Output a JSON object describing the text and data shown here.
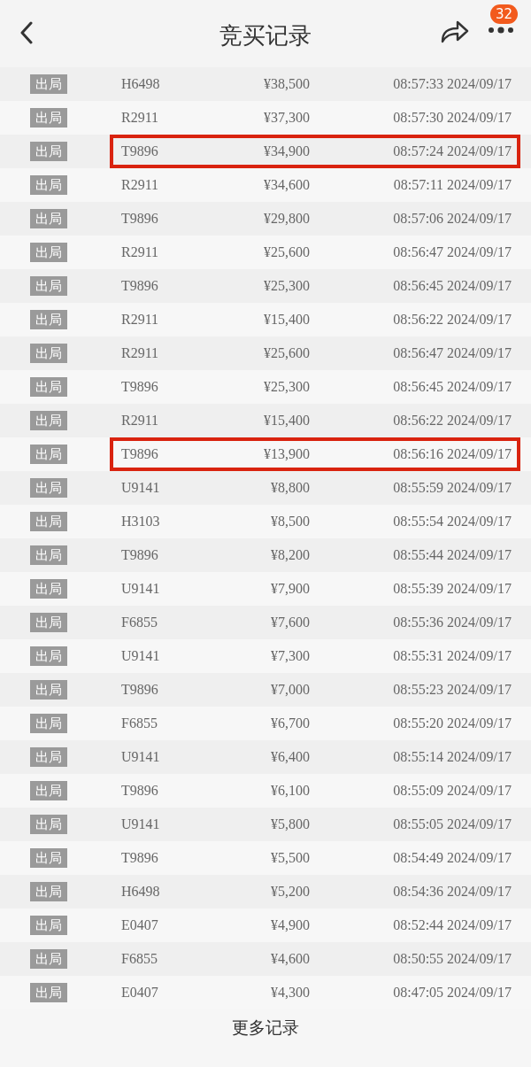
{
  "header": {
    "title": "竞买记录",
    "notification_count": "32"
  },
  "records": [
    {
      "status": "出局",
      "bidder": "H6498",
      "price": "¥38,500",
      "time": "08:57:33 2024/09/17",
      "highlighted": false
    },
    {
      "status": "出局",
      "bidder": "R2911",
      "price": "¥37,300",
      "time": "08:57:30 2024/09/17",
      "highlighted": false
    },
    {
      "status": "出局",
      "bidder": "T9896",
      "price": "¥34,900",
      "time": "08:57:24 2024/09/17",
      "highlighted": true
    },
    {
      "status": "出局",
      "bidder": "R2911",
      "price": "¥34,600",
      "time": "08:57:11 2024/09/17",
      "highlighted": false
    },
    {
      "status": "出局",
      "bidder": "T9896",
      "price": "¥29,800",
      "time": "08:57:06 2024/09/17",
      "highlighted": false
    },
    {
      "status": "出局",
      "bidder": "R2911",
      "price": "¥25,600",
      "time": "08:56:47 2024/09/17",
      "highlighted": false
    },
    {
      "status": "出局",
      "bidder": "T9896",
      "price": "¥25,300",
      "time": "08:56:45 2024/09/17",
      "highlighted": false
    },
    {
      "status": "出局",
      "bidder": "R2911",
      "price": "¥15,400",
      "time": "08:56:22 2024/09/17",
      "highlighted": false
    },
    {
      "status": "出局",
      "bidder": "R2911",
      "price": "¥25,600",
      "time": "08:56:47 2024/09/17",
      "highlighted": false
    },
    {
      "status": "出局",
      "bidder": "T9896",
      "price": "¥25,300",
      "time": "08:56:45 2024/09/17",
      "highlighted": false
    },
    {
      "status": "出局",
      "bidder": "R2911",
      "price": "¥15,400",
      "time": "08:56:22 2024/09/17",
      "highlighted": false
    },
    {
      "status": "出局",
      "bidder": "T9896",
      "price": "¥13,900",
      "time": "08:56:16 2024/09/17",
      "highlighted": true
    },
    {
      "status": "出局",
      "bidder": "U9141",
      "price": "¥8,800",
      "time": "08:55:59 2024/09/17",
      "highlighted": false
    },
    {
      "status": "出局",
      "bidder": "H3103",
      "price": "¥8,500",
      "time": "08:55:54 2024/09/17",
      "highlighted": false
    },
    {
      "status": "出局",
      "bidder": "T9896",
      "price": "¥8,200",
      "time": "08:55:44 2024/09/17",
      "highlighted": false
    },
    {
      "status": "出局",
      "bidder": "U9141",
      "price": "¥7,900",
      "time": "08:55:39 2024/09/17",
      "highlighted": false
    },
    {
      "status": "出局",
      "bidder": "F6855",
      "price": "¥7,600",
      "time": "08:55:36 2024/09/17",
      "highlighted": false
    },
    {
      "status": "出局",
      "bidder": "U9141",
      "price": "¥7,300",
      "time": "08:55:31 2024/09/17",
      "highlighted": false
    },
    {
      "status": "出局",
      "bidder": "T9896",
      "price": "¥7,000",
      "time": "08:55:23 2024/09/17",
      "highlighted": false
    },
    {
      "status": "出局",
      "bidder": "F6855",
      "price": "¥6,700",
      "time": "08:55:20 2024/09/17",
      "highlighted": false
    },
    {
      "status": "出局",
      "bidder": "U9141",
      "price": "¥6,400",
      "time": "08:55:14 2024/09/17",
      "highlighted": false
    },
    {
      "status": "出局",
      "bidder": "T9896",
      "price": "¥6,100",
      "time": "08:55:09 2024/09/17",
      "highlighted": false
    },
    {
      "status": "出局",
      "bidder": "U9141",
      "price": "¥5,800",
      "time": "08:55:05 2024/09/17",
      "highlighted": false
    },
    {
      "status": "出局",
      "bidder": "T9896",
      "price": "¥5,500",
      "time": "08:54:49 2024/09/17",
      "highlighted": false
    },
    {
      "status": "出局",
      "bidder": "H6498",
      "price": "¥5,200",
      "time": "08:54:36 2024/09/17",
      "highlighted": false
    },
    {
      "status": "出局",
      "bidder": "E0407",
      "price": "¥4,900",
      "time": "08:52:44 2024/09/17",
      "highlighted": false
    },
    {
      "status": "出局",
      "bidder": "F6855",
      "price": "¥4,600",
      "time": "08:50:55 2024/09/17",
      "highlighted": false
    },
    {
      "status": "出局",
      "bidder": "E0407",
      "price": "¥4,300",
      "time": "08:47:05 2024/09/17",
      "highlighted": false
    }
  ],
  "more_link": "更多记录"
}
